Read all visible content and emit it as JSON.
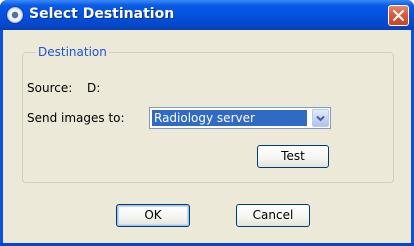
{
  "window": {
    "title": "Select Destination",
    "title_icon": "app-disc-icon",
    "close_icon": "close-icon"
  },
  "group": {
    "legend": "Destination",
    "source_label": "Source:",
    "source_value": "D:",
    "send_label": "Send images to:",
    "send_selected": "Radiology server"
  },
  "buttons": {
    "test": "Test",
    "ok": "OK",
    "cancel": "Cancel"
  },
  "colors": {
    "titlebar": "#0552df",
    "client_bg": "#ece9d8",
    "legend_text": "#1c54d6",
    "selection": "#316ac5",
    "close_button": "#d85a3c"
  }
}
